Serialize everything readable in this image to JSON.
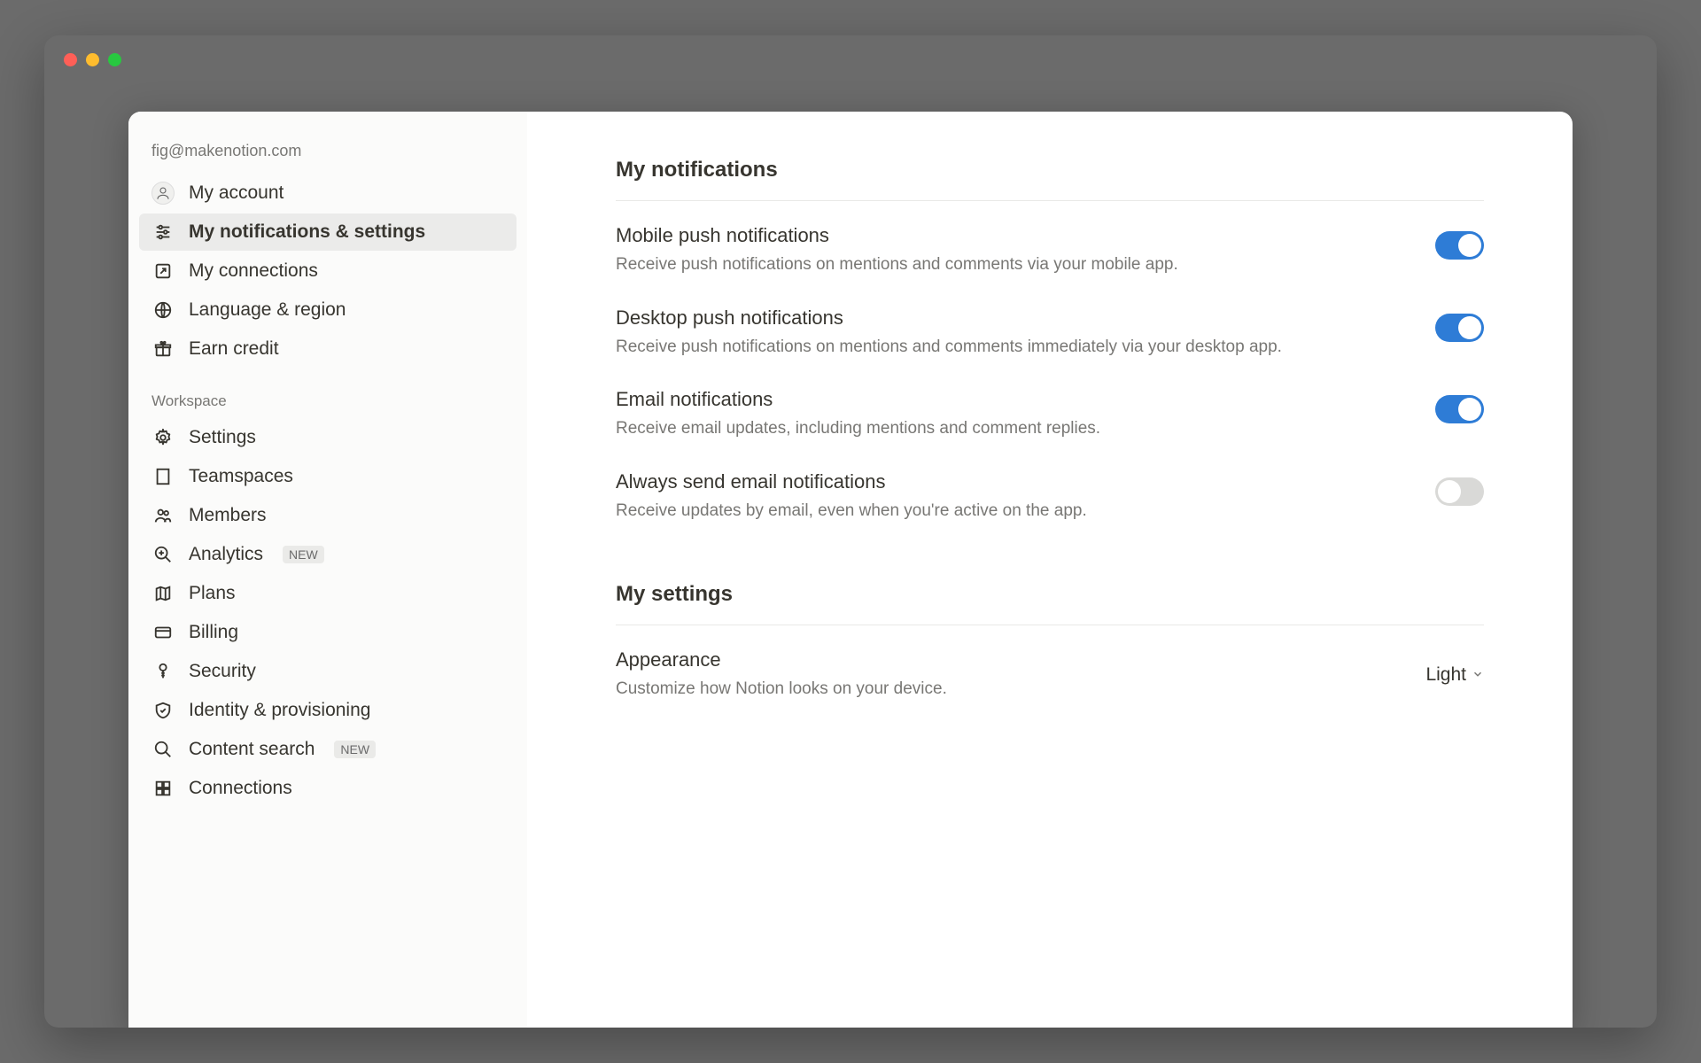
{
  "sidebar": {
    "email": "fig@makenotion.com",
    "items": [
      {
        "label": "My account"
      },
      {
        "label": "My notifications & settings"
      },
      {
        "label": "My connections"
      },
      {
        "label": "Language & region"
      },
      {
        "label": "Earn credit"
      }
    ],
    "workspace_label": "Workspace",
    "workspace_items": [
      {
        "label": "Settings"
      },
      {
        "label": "Teamspaces"
      },
      {
        "label": "Members"
      },
      {
        "label": "Analytics",
        "badge": "NEW"
      },
      {
        "label": "Plans"
      },
      {
        "label": "Billing"
      },
      {
        "label": "Security"
      },
      {
        "label": "Identity & provisioning"
      },
      {
        "label": "Content search",
        "badge": "NEW"
      },
      {
        "label": "Connections"
      }
    ]
  },
  "content": {
    "notifications_title": "My notifications",
    "settings_title": "My settings",
    "rows": [
      {
        "label": "Mobile push notifications",
        "desc": "Receive push notifications on mentions and comments via your mobile app.",
        "on": true
      },
      {
        "label": "Desktop push notifications",
        "desc": "Receive push notifications on mentions and comments immediately via your desktop app.",
        "on": true
      },
      {
        "label": "Email notifications",
        "desc": "Receive email updates, including mentions and comment replies.",
        "on": true
      },
      {
        "label": "Always send email notifications",
        "desc": "Receive updates by email, even when you're active on the app.",
        "on": false
      }
    ],
    "appearance": {
      "label": "Appearance",
      "desc": "Customize how Notion looks on your device.",
      "value": "Light"
    }
  }
}
